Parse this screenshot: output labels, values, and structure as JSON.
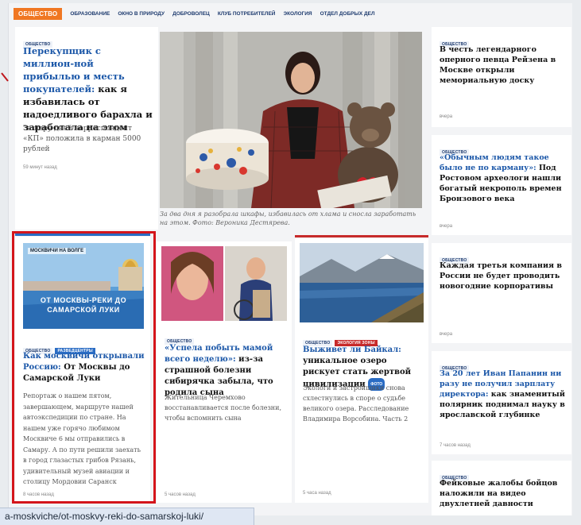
{
  "nav": {
    "section": "ОБЩЕСТВО",
    "items": [
      "ОБРАЗОВАНИЕ",
      "ОКНО В ПРИРОДУ",
      "ДОБРОВОЛЕЦ",
      "КЛУБ ПОТРЕБИТЕЛЕЙ",
      "ЭКОЛОГИЯ",
      "ОТДЕЛ ДОБРЫХ ДЕЛ"
    ]
  },
  "main_story": {
    "tag": "ОБЩЕСТВО",
    "headline_link": "Перекупщик с миллион-ной прибылью и месть покупателей:",
    "headline_rest": " как я избавилась от надоедливого барахла и заработала на этом",
    "lede": "За пару дней корреспондент «КП» положила в карман 5000 рублей",
    "time": "59 минут назад",
    "caption": "За два дня я разобрала шкафы, избавилась от хлама и сносла заработать на этом. Фото: Вероника Дестярева."
  },
  "right_col": [
    {
      "tag": "ОБЩЕСТВО",
      "headline": "В честь легендарного оперного певца Рейзена в Москве открыли мемориальную доску",
      "time": "вчера"
    },
    {
      "tag": "ОБЩЕСТВО",
      "headline_link": "«Обычным людям такое было не по карману»:",
      "headline_rest": " Под Ростовом археологи нашли богатый некрополь времен Бронзового века",
      "time": "вчера"
    },
    {
      "tag": "ОБЩЕСТВО",
      "headline": "Каждая третья компания в России не будет проводить новогодние корпоративы",
      "time": "вчера"
    },
    {
      "tag": "ОБЩЕСТВО",
      "headline_link": "За 20 лет Иван Папанин ни разу не получил зарплату директора:",
      "headline_rest": " как знаменитый полярник поднимал науку в ярославской глубинке",
      "time": "7 часов назад"
    },
    {
      "tag": "ОБЩЕСТВО",
      "headline": "Фейковые жалобы бойцов наложили на видео двухлетней давности",
      "time": ""
    }
  ],
  "story_volga": {
    "tags": [
      "ОБЩЕСТВО",
      "РАЗВЕДЦЕНТРЫ"
    ],
    "image_title": "МОСКВИЧИ НА ВОЛГЕ",
    "image_banner": "ОТ МОСКВЫ-РЕКИ ДО САМАРСКОЙ ЛУКИ",
    "headline_link": "Как москвичи открывали Россию:",
    "headline_rest": " От Москвы до Самарской Луки",
    "lede": "Репортаж о нашем пятом, завершающем, маршруте нашей автоэкспедиции по стране. На нашем уже горячо любимом Москвиче 6 мы отправились в Самару. А по пути решили заехать в город глазастых грибов Рязань, удивительный музей авиации и столицу Мордовии Саранск",
    "time": "8 часов назад"
  },
  "story_mother": {
    "tag": "ОБЩЕСТВО",
    "headline_link": "«Успела побыть мамой всего неделю»:",
    "headline_rest": " из-за страшной болезни сибирячка забыла, что родила сына",
    "lede": "Жительница Черемхово восстанавливается после болезни, чтобы вспомнить сына",
    "time": "5 часов назад"
  },
  "story_baikal": {
    "tags": [
      "ОБЩЕСТВО",
      "ЭКОЛОГИЯ ЗОНЫ"
    ],
    "headline_link": "Выживет ли Байкал:",
    "headline_rest": " уникальное озеро рискует стать жертвой цивилизации",
    "badge": "ФОТО",
    "lede": "Экологи и застройщики снова схлестнулись в споре о судьбе великого озера. Расследование Владимира Ворсобина. Часть 2",
    "time": "5 часа назад"
  },
  "status_url": "a-moskviche/ot-moskvy-reki-do-samarskoj-luki/",
  "colors": {
    "accent_orange": "#f07722",
    "link_blue": "#1b57a8",
    "highlight_red": "#d4151b"
  }
}
